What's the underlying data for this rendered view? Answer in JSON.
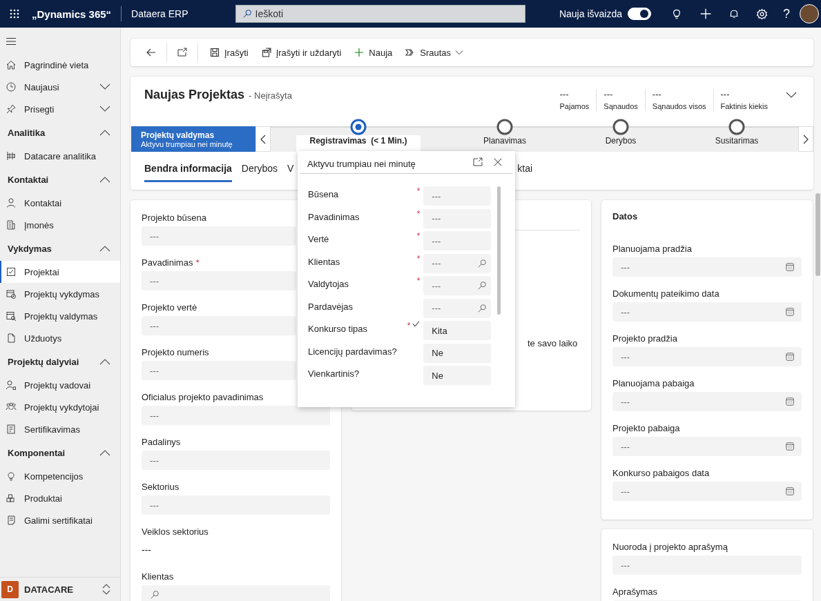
{
  "topbar": {
    "brand": "„Dynamics 365“",
    "app": "Dataera ERP",
    "search": {
      "placeholder": "Ieškoti"
    },
    "toggle": {
      "label": "Nauja išvaizda",
      "on": true
    },
    "help": "?"
  },
  "sidebar": {
    "top_items": [
      {
        "label": "Pagrindinė vieta",
        "kind": "link"
      },
      {
        "label": "Naujausi",
        "kind": "menu",
        "expanded": false
      },
      {
        "label": "Prisegti",
        "kind": "menu",
        "expanded": false
      }
    ],
    "groups": [
      {
        "title": "Analitika",
        "expanded": true,
        "items": [
          {
            "label": "Datacare analitika",
            "selected": false
          }
        ]
      },
      {
        "title": "Kontaktai",
        "expanded": true,
        "items": [
          {
            "label": "Kontaktai",
            "selected": false
          },
          {
            "label": "Įmonės",
            "selected": false
          }
        ]
      },
      {
        "title": "Vykdymas",
        "expanded": true,
        "items": [
          {
            "label": "Projektai",
            "selected": true
          },
          {
            "label": "Projektų vykdymas",
            "selected": false
          },
          {
            "label": "Projektų valdymas",
            "selected": false
          },
          {
            "label": "Užduotys",
            "selected": false
          }
        ]
      },
      {
        "title": "Projektų dalyviai",
        "expanded": true,
        "items": [
          {
            "label": "Projektų vadovai",
            "selected": false
          },
          {
            "label": "Projektų vykdytojai",
            "selected": false
          },
          {
            "label": "Sertifikavimas",
            "selected": false
          }
        ]
      },
      {
        "title": "Komponentai",
        "expanded": true,
        "items": [
          {
            "label": "Kompetencijos",
            "selected": false
          },
          {
            "label": "Produktai",
            "selected": false
          },
          {
            "label": "Galimi sertifikatai",
            "selected": false
          }
        ]
      }
    ],
    "area": {
      "initial": "D",
      "name": "DATACARE",
      "color": "#c4511e"
    }
  },
  "command_bar": {
    "buttons": [
      {
        "label": "Įrašyti",
        "kind": "save"
      },
      {
        "label": "Įrašyti ir uždaryti",
        "kind": "save-close"
      },
      {
        "label": "Nauja",
        "kind": "new"
      },
      {
        "label": "Srautas",
        "kind": "flow-menu"
      }
    ]
  },
  "header": {
    "title": "Naujas Projektas",
    "status": "- Neįrašyta",
    "kpis": [
      {
        "value": "---",
        "label": "Pajamos"
      },
      {
        "value": "---",
        "label": "Sąnaudos"
      },
      {
        "value": "---",
        "label": "Sąnaudos visos"
      },
      {
        "value": "---",
        "label": "Faktinis kiekis"
      }
    ]
  },
  "process": {
    "active": {
      "title": "Projektų valdymas",
      "subtitle": "Aktyvu trumpiau nei minutę"
    },
    "stages": [
      {
        "name": "Registravimas",
        "duration": "(< 1 Min.)",
        "selected": true
      },
      {
        "name": "Planavimas",
        "selected": false
      },
      {
        "name": "Derybos",
        "selected": false
      },
      {
        "name": "Susitarimas",
        "selected": false
      }
    ]
  },
  "tabs": [
    {
      "label": "Bendra informacija",
      "selected": true
    },
    {
      "label": "Derybos",
      "selected": false
    },
    {
      "label": "V",
      "selected": false
    },
    {
      "label": "ktai",
      "selected": false
    }
  ],
  "main_form": {
    "fields": [
      {
        "label": "Projekto būsena",
        "value": "---",
        "kind": "text"
      },
      {
        "label": "Pavadinimas",
        "required_mark": "*",
        "value": "---",
        "kind": "text"
      },
      {
        "label": "Projekto vertė",
        "value": "---",
        "kind": "text"
      },
      {
        "label": "Projekto numeris",
        "value": "---",
        "kind": "text"
      },
      {
        "label": "Oficialus projekto pavadinimas",
        "value": "---",
        "kind": "text"
      },
      {
        "label": "Padalinys",
        "value": "---",
        "kind": "text"
      },
      {
        "label": "Sektorius",
        "value": "---",
        "kind": "text"
      },
      {
        "label": "Veiklos sektorius",
        "value": "---",
        "kind": "plain"
      },
      {
        "label": "Klientas",
        "kind": "lookup"
      }
    ]
  },
  "middle_card": {
    "text": "te savo laiko"
  },
  "dates_card": {
    "title": "Datos",
    "fields": [
      {
        "label": "Planuojama pradžia",
        "value": "---",
        "kind": "date"
      },
      {
        "label": "Dokumentų pateikimo data",
        "value": "---",
        "kind": "date"
      },
      {
        "label": "Projekto pradžia",
        "value": "---",
        "kind": "date"
      },
      {
        "label": "Planuojama pabaiga",
        "value": "---",
        "kind": "date"
      },
      {
        "label": "Projekto pabaiga",
        "value": "---",
        "kind": "date"
      },
      {
        "label": "Konkurso pabaigos data",
        "value": "---",
        "kind": "date"
      }
    ]
  },
  "description_card": {
    "fields": [
      {
        "label": "Nuoroda į projekto aprašymą",
        "value": "---"
      },
      {
        "label": "Aprašymas"
      }
    ]
  },
  "flyout": {
    "title": "Aktyvu trumpiau nei minutę",
    "fields": [
      {
        "label": "Būsena",
        "required_mark": "*",
        "valid": false,
        "value": "---",
        "kind": "text"
      },
      {
        "label": "Pavadinimas",
        "required_mark": "*",
        "valid": false,
        "value": "---",
        "kind": "text"
      },
      {
        "label": "Vertė",
        "required_mark": "*",
        "valid": false,
        "value": "---",
        "kind": "text"
      },
      {
        "label": "Klientas",
        "required_mark": "*",
        "valid": false,
        "value": "---",
        "kind": "lookup"
      },
      {
        "label": "Valdytojas",
        "required_mark": "*",
        "valid": false,
        "value": "---",
        "kind": "lookup"
      },
      {
        "label": "Pardavėjas",
        "valid": false,
        "value": "---",
        "kind": "lookup"
      },
      {
        "label": "Konkurso tipas",
        "required_mark": "*",
        "valid": true,
        "value": "Kita",
        "kind": "text"
      },
      {
        "label": "Licencijų pardavimas?",
        "valid": false,
        "value": "Ne",
        "kind": "text"
      },
      {
        "label": "Vienkartinis?",
        "valid": false,
        "value": "Ne",
        "kind": "text"
      }
    ]
  }
}
